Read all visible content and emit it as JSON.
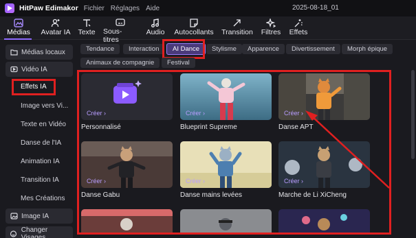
{
  "titlebar": {
    "app_name": "HitPaw Edimakor",
    "menu": [
      "Fichier",
      "Réglages",
      "Aide"
    ],
    "project_title": "2025-08-18_01"
  },
  "toolbar": {
    "tools": [
      {
        "label": "Médias",
        "icon": "media-icon",
        "active": true
      },
      {
        "label": "Avatar IA",
        "icon": "avatar-icon",
        "active": false
      },
      {
        "label": "Texte",
        "icon": "text-icon",
        "active": false
      },
      {
        "label": "Sous-titres",
        "icon": "subtitles-icon",
        "active": false
      },
      {
        "label": "Audio",
        "icon": "music-note-icon",
        "active": false
      },
      {
        "label": "Autocollants",
        "icon": "sticker-icon",
        "active": false
      },
      {
        "label": "Transition",
        "icon": "transition-icon",
        "active": false
      },
      {
        "label": "Filtres",
        "icon": "sparkle-icon",
        "active": false
      },
      {
        "label": "Effets",
        "icon": "effects-icon",
        "active": false
      }
    ]
  },
  "sidebar": {
    "groups": [
      {
        "label": "Médias locaux",
        "icon": "folder-icon"
      },
      {
        "label": "Vidéo IA",
        "icon": "video-icon"
      },
      {
        "label": "Image IA",
        "icon": "image-icon"
      },
      {
        "label": "Changer Visages",
        "icon": "face-icon"
      }
    ],
    "sub_items": [
      "Effets IA",
      "Image vers Vi...",
      "Texte en Vidéo",
      "Danse de l'IA",
      "Animation IA",
      "Transition IA",
      "Mes Créations"
    ]
  },
  "tags": [
    "Tendance",
    "Interaction",
    "AI Dance",
    "Stylisme",
    "Apparence",
    "Divertissement",
    "Morph épique",
    "Animaux de compagnie",
    "Festival"
  ],
  "active_tag": "AI Dance",
  "cards": [
    {
      "title": "Personnalisé",
      "action": "Créer"
    },
    {
      "title": "Blueprint Supreme",
      "action": "Créer"
    },
    {
      "title": "Danse APT",
      "action": "Créer"
    },
    {
      "title": "Danse Gabu",
      "action": "Créer"
    },
    {
      "title": "Danse mains levées",
      "action": "Créer"
    },
    {
      "title": "Marche de Li XiCheng",
      "action": "Créer"
    }
  ],
  "colors": {
    "accent": "#8f6bff",
    "highlight": "#e02020",
    "panel": "#1a1a1f"
  }
}
